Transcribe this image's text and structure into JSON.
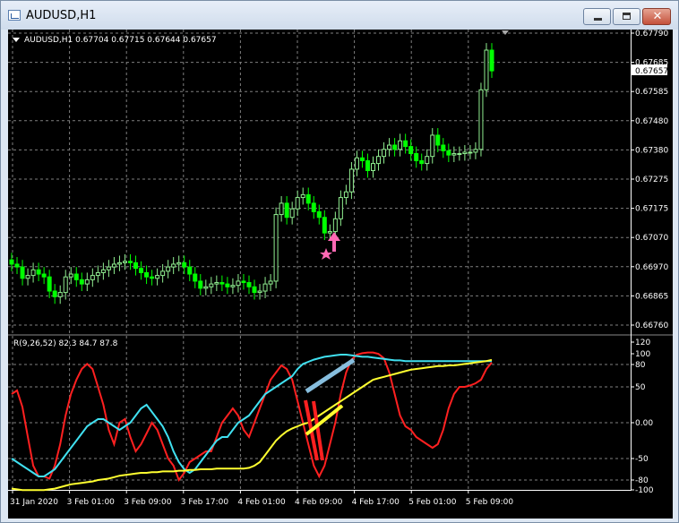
{
  "window": {
    "title": "AUDUSD,H1",
    "close_glyph": "✕"
  },
  "main_chart": {
    "header": "AUDUSD,H1  0.67704 0.67715 0.67644 0.67657",
    "price_ticks": [
      "0.67790",
      "0.67685",
      "0.67585",
      "0.67480",
      "0.67380",
      "0.67275",
      "0.67175",
      "0.67070",
      "0.66970",
      "0.66865",
      "0.66760"
    ],
    "current_price": "0.67657",
    "bull_color": "#90ee90",
    "bear_color": "#00ff00",
    "bar_values": [
      0.66975,
      0.66965,
      0.66925,
      0.66935,
      0.66955,
      0.6694,
      0.6693,
      0.6688,
      0.6686,
      0.66875,
      0.6693,
      0.6694,
      0.6692,
      0.66905,
      0.6692,
      0.66935,
      0.66945,
      0.66955,
      0.66965,
      0.66975,
      0.6698,
      0.66985,
      0.6698,
      0.6696,
      0.66945,
      0.6693,
      0.66925,
      0.66935,
      0.6695,
      0.66965,
      0.66975,
      0.6698,
      0.66965,
      0.6694,
      0.66915,
      0.6689,
      0.66895,
      0.66905,
      0.6691,
      0.66905,
      0.66895,
      0.669,
      0.66915,
      0.6691,
      0.66895,
      0.66875,
      0.6688,
      0.66905,
      0.66915,
      0.6715,
      0.6719,
      0.6714,
      0.6717,
      0.6721,
      0.6722,
      0.6719,
      0.6716,
      0.6714,
      0.67085,
      0.6709,
      0.67135,
      0.6721,
      0.6723,
      0.6731,
      0.6735,
      0.6734,
      0.67305,
      0.6733,
      0.67355,
      0.6738,
      0.67395,
      0.6738,
      0.6741,
      0.6739,
      0.67365,
      0.6734,
      0.6733,
      0.67355,
      0.6743,
      0.67395,
      0.67375,
      0.6736,
      0.67365,
      0.67365,
      0.6737,
      0.6737,
      0.6738,
      0.6759,
      0.6773,
      0.67657
    ],
    "arrow_color": "#ff69b4"
  },
  "oscillator": {
    "label": "R(9,26,52) 82.3 84.7 87.8",
    "ticks": [
      "120",
      "100",
      "80",
      "50",
      "0.00",
      "-50",
      "-80",
      "-100"
    ],
    "series": [
      {
        "color": "#ff2020",
        "values": [
          40,
          45,
          22,
          -20,
          -60,
          -75,
          -75,
          -78,
          -60,
          -30,
          10,
          40,
          60,
          75,
          82,
          75,
          50,
          25,
          -10,
          -30,
          0,
          5,
          -20,
          -40,
          -30,
          -15,
          0,
          -10,
          -30,
          -50,
          -60,
          -80,
          -70,
          -55,
          -50,
          -45,
          -40,
          -40,
          -20,
          0,
          10,
          20,
          10,
          -10,
          -20,
          0,
          20,
          40,
          60,
          70,
          80,
          75,
          60,
          30,
          0,
          -30,
          -60,
          -75,
          -60,
          -30,
          0,
          40,
          70,
          88,
          95,
          97,
          98,
          98,
          96,
          90,
          70,
          40,
          10,
          -5,
          -10,
          -20,
          -25,
          -30,
          -35,
          -30,
          -10,
          20,
          40,
          50,
          50,
          52,
          55,
          60,
          75,
          84
        ]
      },
      {
        "color": "#40e0f0",
        "values": [
          -50,
          -55,
          -60,
          -65,
          -70,
          -75,
          -75,
          -70,
          -65,
          -55,
          -45,
          -35,
          -25,
          -15,
          -5,
          0,
          5,
          5,
          0,
          -5,
          -10,
          -5,
          0,
          10,
          20,
          25,
          15,
          5,
          -5,
          -20,
          -40,
          -55,
          -65,
          -70,
          -65,
          -55,
          -45,
          -35,
          -25,
          -20,
          -20,
          -10,
          0,
          5,
          10,
          20,
          30,
          40,
          45,
          50,
          55,
          60,
          65,
          75,
          82,
          85,
          88,
          90,
          92,
          93,
          94,
          95,
          95,
          94,
          93,
          92,
          92,
          91,
          90,
          89,
          88,
          87,
          87,
          86,
          86,
          86,
          86,
          86,
          86,
          86,
          86,
          86,
          86,
          86,
          86,
          86,
          86,
          86,
          86,
          86
        ]
      },
      {
        "color": "#ffff30",
        "values": [
          -92,
          -93,
          -94,
          -94,
          -94,
          -94,
          -94,
          -93,
          -92,
          -90,
          -88,
          -86,
          -85,
          -84,
          -83,
          -82,
          -80,
          -79,
          -78,
          -76,
          -74,
          -73,
          -72,
          -71,
          -70,
          -70,
          -69,
          -69,
          -68,
          -68,
          -68,
          -67,
          -67,
          -66,
          -66,
          -65,
          -65,
          -65,
          -64,
          -64,
          -64,
          -64,
          -64,
          -64,
          -63,
          -60,
          -55,
          -45,
          -35,
          -25,
          -18,
          -12,
          -8,
          -5,
          -2,
          0,
          5,
          10,
          15,
          20,
          25,
          30,
          35,
          40,
          45,
          50,
          55,
          60,
          62,
          64,
          66,
          68,
          70,
          72,
          74,
          75,
          76,
          77,
          78,
          79,
          79,
          80,
          80,
          81,
          82,
          83,
          84,
          85,
          86,
          87.8
        ]
      }
    ]
  },
  "time_axis": [
    "31 Jan 2020",
    "3 Feb 01:00",
    "3 Feb 09:00",
    "3 Feb 17:00",
    "4 Feb 01:00",
    "4 Feb 09:00",
    "4 Feb 17:00",
    "5 Feb 01:00",
    "5 Feb 09:00"
  ],
  "icons": [
    "chart-window-icon",
    "minimize-icon",
    "maximize-icon",
    "close-icon",
    "buy-arrow-icon",
    "star-icon",
    "dropdown-triangle-icon",
    "ask-marker-icon"
  ]
}
